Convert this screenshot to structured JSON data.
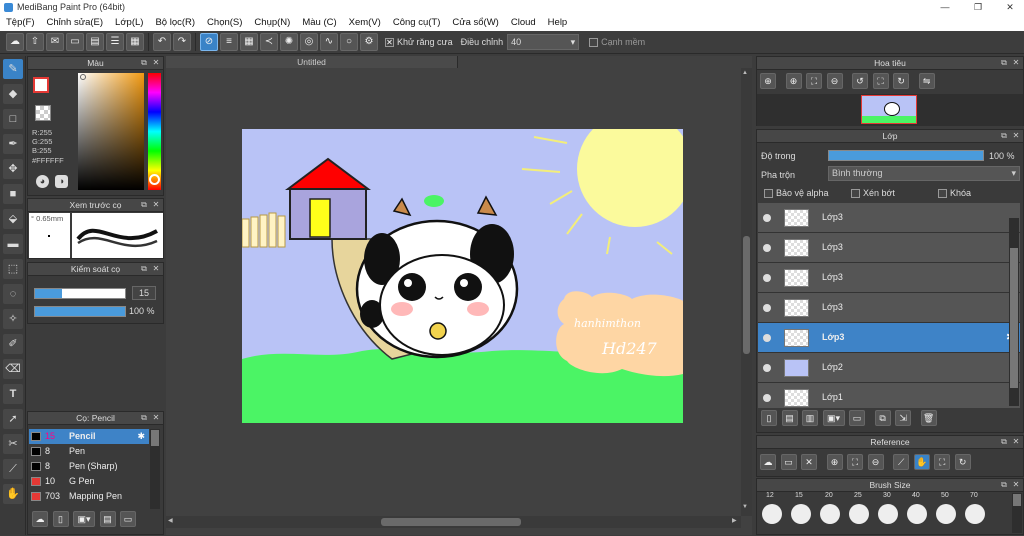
{
  "window": {
    "title": "MediBang Paint Pro (64bit)"
  },
  "menu": [
    "Tệp(F)",
    "Chỉnh sửa(E)",
    "Lớp(L)",
    "Bộ lọc(R)",
    "Chọn(S)",
    "Chụp(N)",
    "Màu (C)",
    "Xem(V)",
    "Công cụ(T)",
    "Cửa sổ(W)",
    "Cloud",
    "Help"
  ],
  "toolbar": {
    "antialias_label": "Khử răng cưa",
    "adjust_label": "Điều chỉnh",
    "adjust_value": "40",
    "smooth_label": "Cạnh mềm"
  },
  "color_panel": {
    "title": "Màu",
    "r": "R:255",
    "g": "G:255",
    "b": "B:255",
    "hex": "#FFFFFF"
  },
  "preview_panel": {
    "title": "Xem trước cọ",
    "size": "0.65mm"
  },
  "brush_control": {
    "title": "Kiểm soát cọ",
    "size": "15",
    "opacity": "100 %"
  },
  "brush_panel": {
    "title": "Cọ: Pencil",
    "items": [
      {
        "size": "15",
        "name": "Pencil",
        "color": "#000000"
      },
      {
        "size": "8",
        "name": "Pen",
        "color": "#000000"
      },
      {
        "size": "8",
        "name": "Pen (Sharp)",
        "color": "#000000"
      },
      {
        "size": "10",
        "name": "G Pen",
        "color": "#e53935"
      },
      {
        "size": "703",
        "name": "Mapping Pen",
        "color": "#e53935"
      }
    ]
  },
  "document": {
    "tab": "Untitled"
  },
  "artwork": {
    "text1": "hanhimthon",
    "text2": "Hd247"
  },
  "navigator": {
    "title": "Hoa tiêu"
  },
  "layer_panel": {
    "title": "Lớp",
    "opacity_label": "Độ trong",
    "opacity_value": "100 %",
    "blend_label": "Pha trộn",
    "blend_value": "Bình thường",
    "protect_alpha": "Bảo vệ alpha",
    "clipping": "Xén bớt",
    "lock": "Khóa",
    "layers": [
      "Lớp3",
      "Lớp3",
      "Lớp3",
      "Lớp3",
      "Lớp3",
      "Lớp2",
      "Lớp1"
    ]
  },
  "reference_panel": {
    "title": "Reference"
  },
  "brush_size_panel": {
    "title": "Brush Size",
    "sizes": [
      "12",
      "15",
      "20",
      "25",
      "30",
      "40",
      "50",
      "70"
    ]
  }
}
